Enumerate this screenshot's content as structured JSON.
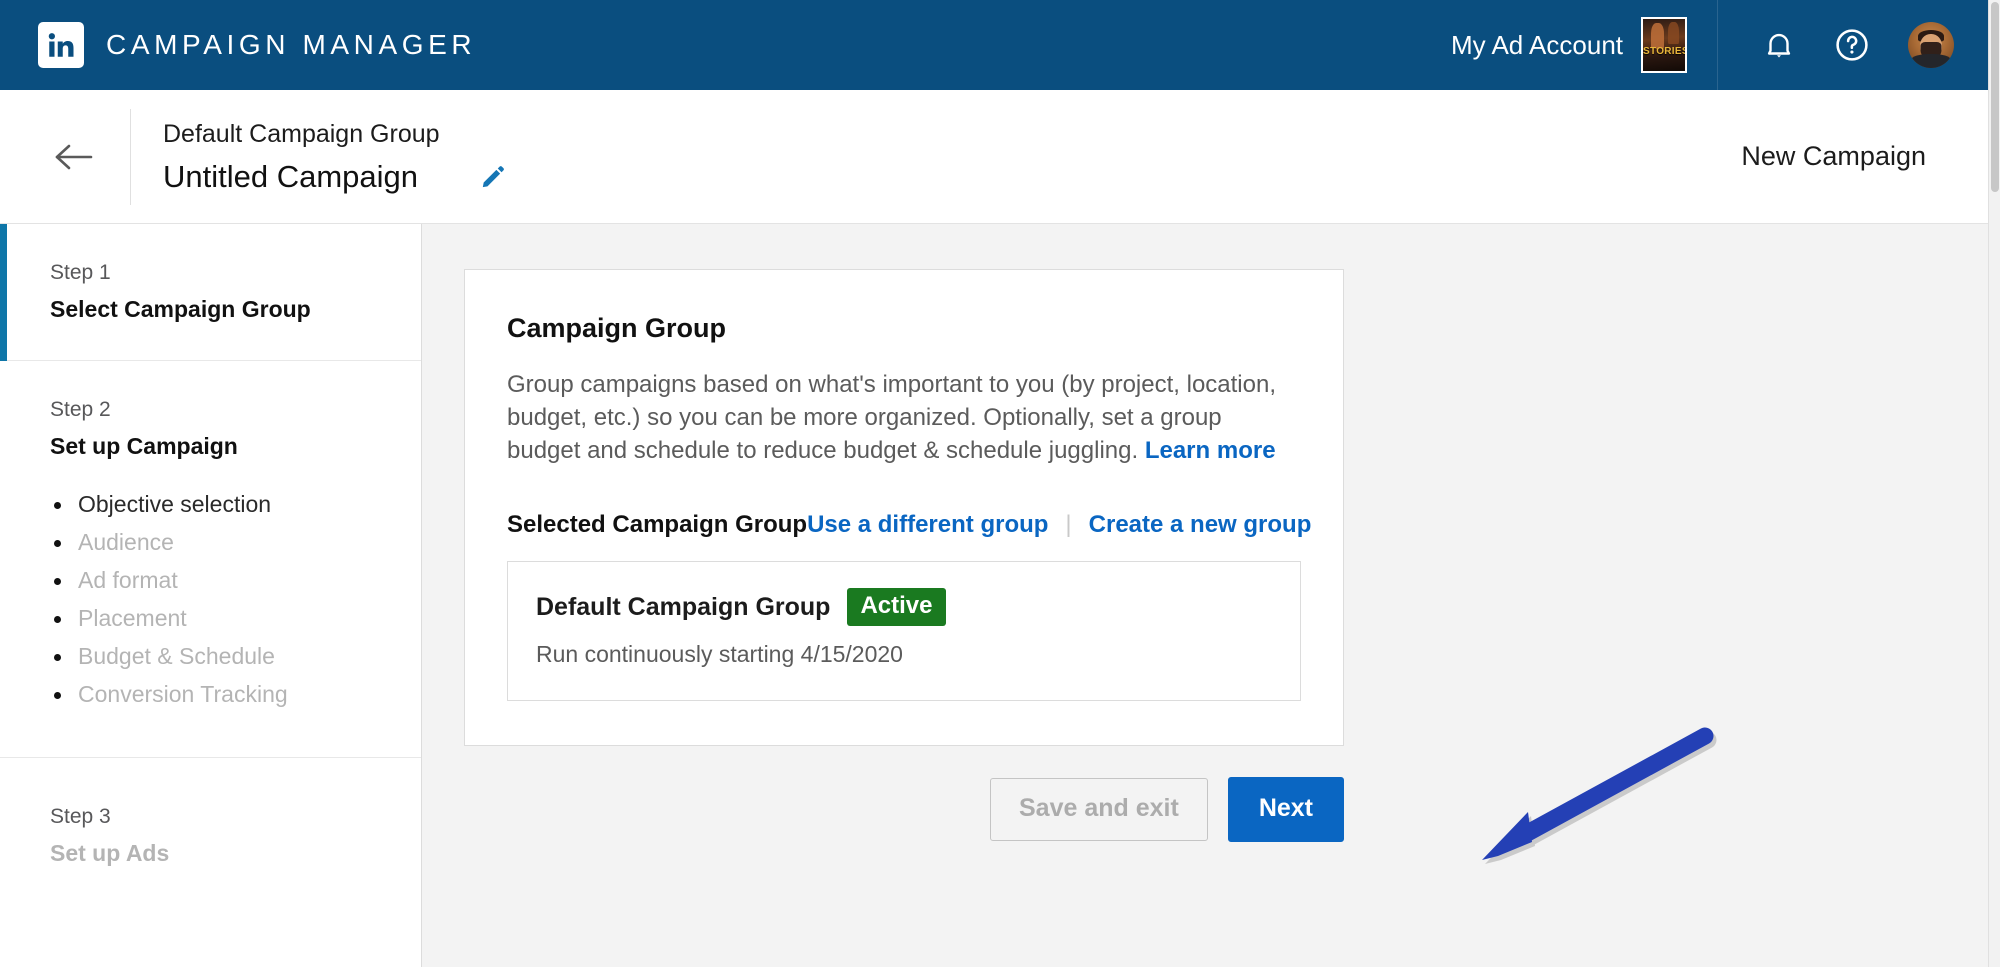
{
  "topbar": {
    "logo_icon": "linkedin-logo-icon",
    "brand": "CAMPAIGN MANAGER",
    "account_name": "My Ad Account",
    "account_thumb_label": "STORIES",
    "account_thumb_icon": "ad-account-thumbnail",
    "notifications_icon": "bell-icon",
    "help_icon": "question-circle-icon",
    "avatar_icon": "user-avatar"
  },
  "titlebar": {
    "back_icon": "back-arrow-icon",
    "group_name": "Default Campaign Group",
    "campaign_name": "Untitled Campaign",
    "edit_icon": "pencil-edit-icon",
    "new_campaign": "New Campaign"
  },
  "sidebar": {
    "steps": [
      {
        "label": "Step 1",
        "title": "Select Campaign Group",
        "active": true,
        "muted": false,
        "substeps": []
      },
      {
        "label": "Step 2",
        "title": "Set up Campaign",
        "active": false,
        "muted": false,
        "substeps": [
          {
            "label": "Objective selection",
            "current": true
          },
          {
            "label": "Audience",
            "current": false
          },
          {
            "label": "Ad format",
            "current": false
          },
          {
            "label": "Placement",
            "current": false
          },
          {
            "label": "Budget & Schedule",
            "current": false
          },
          {
            "label": "Conversion Tracking",
            "current": false
          }
        ]
      },
      {
        "label": "Step 3",
        "title": "Set up Ads",
        "active": false,
        "muted": true,
        "substeps": []
      }
    ]
  },
  "card": {
    "title": "Campaign Group",
    "description": "Group campaigns based on what's important to you (by project, location, budget, etc.) so you can be more organized. Optionally, set a group budget and schedule to reduce budget & schedule juggling.",
    "learn_more": "Learn more",
    "selected_label": "Selected Campaign Group",
    "use_different_group": "Use a different group",
    "separator": "|",
    "create_new_group": "Create a new group",
    "group": {
      "name": "Default Campaign Group",
      "status": "Active",
      "schedule": "Run continuously starting 4/15/2020"
    }
  },
  "footer": {
    "save_and_exit": "Save and exit",
    "next": "Next"
  },
  "annotation": {
    "arrow_icon": "pointer-arrow-icon",
    "arrow_color": "#2440b5"
  },
  "colors": {
    "nav_blue": "#0a4e7f",
    "accent_blue": "#0a66c2",
    "active_step_blue": "#0e76a8",
    "badge_green": "#1a7a20",
    "page_background": "#f3f3f3"
  }
}
